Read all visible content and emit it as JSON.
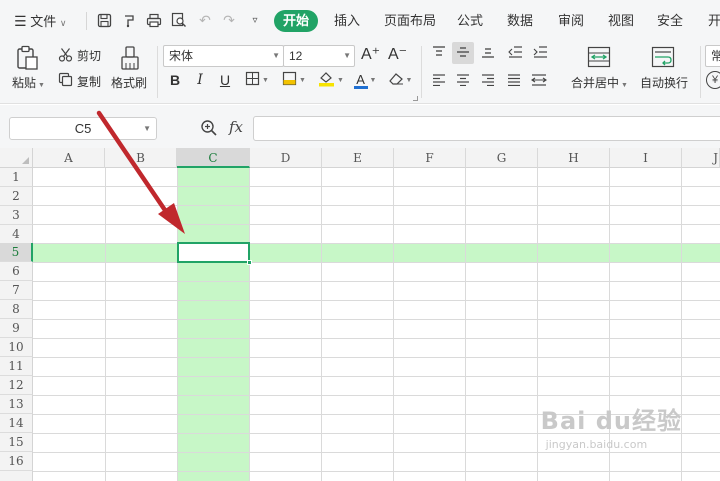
{
  "menu": {
    "file_label": "文件",
    "tabs": [
      {
        "label": "开始",
        "active": true
      },
      {
        "label": "插入"
      },
      {
        "label": "页面布局"
      },
      {
        "label": "公式"
      },
      {
        "label": "数据"
      },
      {
        "label": "审阅"
      },
      {
        "label": "视图"
      },
      {
        "label": "安全"
      },
      {
        "label": "开"
      }
    ],
    "quick_access_icons": [
      "save-icon",
      "paint-format-icon",
      "print-icon",
      "print-preview-icon",
      "undo-icon",
      "redo-icon",
      "more-dropdown-icon"
    ]
  },
  "ribbon": {
    "paste_label": "粘贴",
    "cut_label": "剪切",
    "copy_label": "复制",
    "format_painter_label": "格式刷",
    "font_name": "宋体",
    "font_size": "12",
    "increase_font_label": "A⁺",
    "decrease_font_label": "A⁻",
    "bold_label": "B",
    "italic_label": "I",
    "underline_label": "U",
    "font_color_label": "A",
    "merge_center_label": "合并居中",
    "wrap_text_label": "自动换行",
    "number_format_label": "常",
    "currency_label": "¥",
    "font_color": "#1f6fd1",
    "fill_color": "#f7e300"
  },
  "formula_bar": {
    "name_box": "C5",
    "fx_label": "fx",
    "formula_value": ""
  },
  "sheet": {
    "columns": [
      "A",
      "B",
      "C",
      "D",
      "E",
      "F",
      "G",
      "H",
      "I",
      "J"
    ],
    "rows": [
      "1",
      "2",
      "3",
      "4",
      "5",
      "6",
      "7",
      "8",
      "9",
      "10",
      "11",
      "12",
      "13",
      "14",
      "15",
      "16"
    ],
    "active_cell": "C5",
    "active_column": "C",
    "active_row": "5",
    "highlight_color": "#c7f7c7",
    "accent_color": "#21a366"
  },
  "annotation": {
    "arrow_color": "#c0282d"
  },
  "watermark": {
    "brand": "Bai du经验",
    "url": "jingyan.baidu.com"
  }
}
